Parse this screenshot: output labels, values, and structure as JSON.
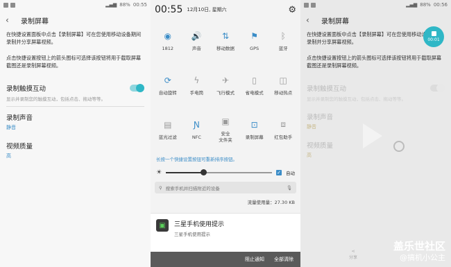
{
  "left_screen": {
    "status": {
      "battery": "88%",
      "time": "00:55"
    },
    "title": "录制屏幕",
    "description1": "在快捷设置面板中点击【录制屏幕】可在您使用移动设备期间录制并分享屏幕视频。",
    "description2": "点击快捷设置按钮上的箭头图标可选择该按钮将用于截取屏幕截图还是录制屏幕视频。",
    "touch": {
      "title": "录制触摸互动",
      "sub": "显示并录制您的触摸互动，包括点击、拖动等等。"
    },
    "sound": {
      "title": "录制声音",
      "value": "静音"
    },
    "quality": {
      "title": "视频质量",
      "value": "高"
    }
  },
  "quick_panel": {
    "time": "00:55",
    "date": "12月10日, 星期六",
    "tiles": [
      {
        "label": "1812",
        "icon": "wifi-icon",
        "on": true
      },
      {
        "label": "声音",
        "icon": "sound-icon",
        "on": true
      },
      {
        "label": "移动数据",
        "icon": "data-icon",
        "on": true
      },
      {
        "label": "GPS",
        "icon": "gps-icon",
        "on": true
      },
      {
        "label": "蓝牙",
        "icon": "bluetooth-icon",
        "on": false
      },
      {
        "label": "自动旋转",
        "icon": "rotate-icon",
        "on": true
      },
      {
        "label": "手电筒",
        "icon": "flashlight-icon",
        "on": false
      },
      {
        "label": "飞行模式",
        "icon": "airplane-icon",
        "on": false
      },
      {
        "label": "省电模式",
        "icon": "battery-saver-icon",
        "on": false
      },
      {
        "label": "移动热点",
        "icon": "hotspot-icon",
        "on": false
      },
      {
        "label": "蓝光过滤",
        "icon": "blue-light-icon",
        "on": false
      },
      {
        "label": "NFC",
        "icon": "nfc-icon",
        "on": true
      },
      {
        "label": "安全\n文件夹",
        "icon": "secure-folder-icon",
        "on": false
      },
      {
        "label": "录制屏幕",
        "icon": "screen-record-icon",
        "on": true
      },
      {
        "label": "红包助手",
        "icon": "red-packet-icon",
        "on": false
      }
    ],
    "hint": "长按一个快捷设置按钮可重新排序按钮。",
    "brightness_level": 0.35,
    "auto_label": "自动",
    "search_placeholder": "搜索手机并扫描附近的设备",
    "data_usage": "流量使用量：27.30 KB",
    "notification": {
      "title": "三星手机使用提示",
      "sub": "三星手机使用提示"
    },
    "buttons": {
      "block": "阻止通知",
      "clear": "全部清除"
    }
  },
  "right_screen": {
    "status": {
      "battery": "88%",
      "time": "00:56"
    },
    "title": "录制屏幕",
    "description1": "在快捷设置面板中点击【录制屏幕】可在您使用移动设备期间录制并分享屏幕视频。",
    "description2": "点击快捷设置按钮上的箭头图标可选择该按钮将用于截取屏幕截图还是录制屏幕视频。",
    "touch": {
      "title": "录制触摸互动",
      "sub": "显示并录制您的触摸互动，包括点击、拖动等等。"
    },
    "sound": {
      "title": "录制声音",
      "value": "静音"
    },
    "quality": {
      "title": "视频质量",
      "value": "高"
    },
    "rec_timer": "00:01",
    "share_label": "分享",
    "watermark1": "盖乐世社区",
    "watermark2": "@搞机小公主"
  },
  "colors": {
    "accent": "#3a8cc7",
    "teal": "#2fb7c6"
  }
}
